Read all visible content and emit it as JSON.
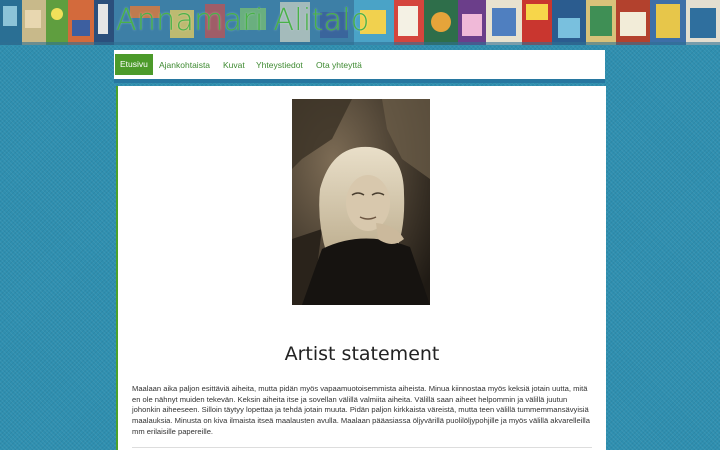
{
  "header": {
    "site_title": "Annamari Alitalo",
    "banner_image": "painting-collage-banner"
  },
  "nav": {
    "items": [
      {
        "label": "Etusivu",
        "active": true
      },
      {
        "label": "Ajankohtaista",
        "active": false
      },
      {
        "label": "Kuvat",
        "active": false
      },
      {
        "label": "Yhteystiedot",
        "active": false
      },
      {
        "label": "Ota yhteyttä",
        "active": false
      }
    ]
  },
  "main": {
    "portrait": "artist-portrait-photo",
    "heading": "Artist statement",
    "paragraph": "Maalaan aika paljon esittäviä aiheita, mutta pidän myös vapaamuotoisemmista aiheista. Minua kiinnostaa myös keksiä jotain uutta, mitä en ole nähnyt muiden tekevän. Keksin aiheita itse ja sovellan välillä valmiita aiheita. Välillä saan aiheet helpommin ja välillä juutun johonkin aiheeseen. Silloin täytyy lopettaa ja tehdä jotain muuta. Pidän paljon kirkkaista väreistä, mutta teen välillä tummemmansävyisiä maalauksia. Minusta on kiva ilmaista itseä maalausten avulla. Maalaan pääasiassa öljyvärillä puolilöljypohjille ja myös välillä akvarelleilla mm erilaisille papereille."
  },
  "colors": {
    "background": "#2f8fb0",
    "accent_green": "#4c9a2a",
    "title_green": "#49b248",
    "nav_border": "#2777a0"
  }
}
